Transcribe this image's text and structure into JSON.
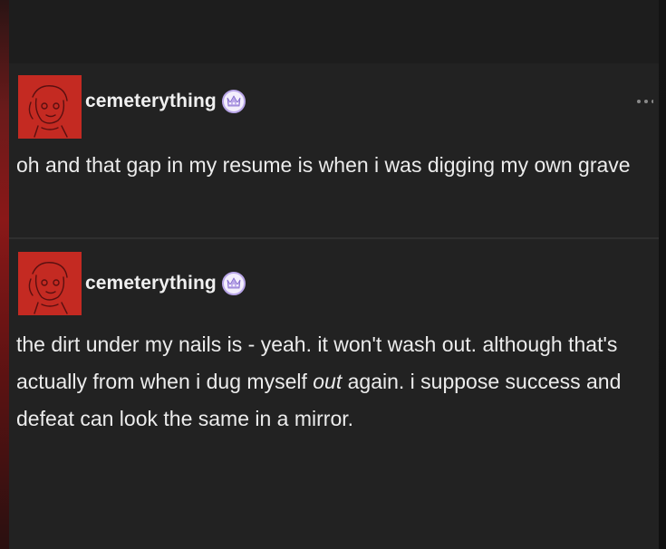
{
  "posts": [
    {
      "username": "cemeterything",
      "badge_icon": "verified-badge-icon",
      "avatar": "red-avatar-sketch",
      "text": "oh and that gap in my resume is when i was digging my own grave"
    },
    {
      "username": "cemeterything",
      "badge_icon": "verified-badge-icon",
      "avatar": "red-avatar-sketch",
      "text_before": "the dirt under my nails is - yeah. it won't wash out. although that's actually from when i dug myself ",
      "text_emphasis": "out",
      "text_after": " again. i suppose success and defeat can look the same in a mirror."
    }
  ],
  "colors": {
    "background": "#1b1b1b",
    "post_background": "#222222",
    "avatar_red": "#c42a22",
    "text": "#ececec",
    "badge": "#b9a6e8"
  }
}
